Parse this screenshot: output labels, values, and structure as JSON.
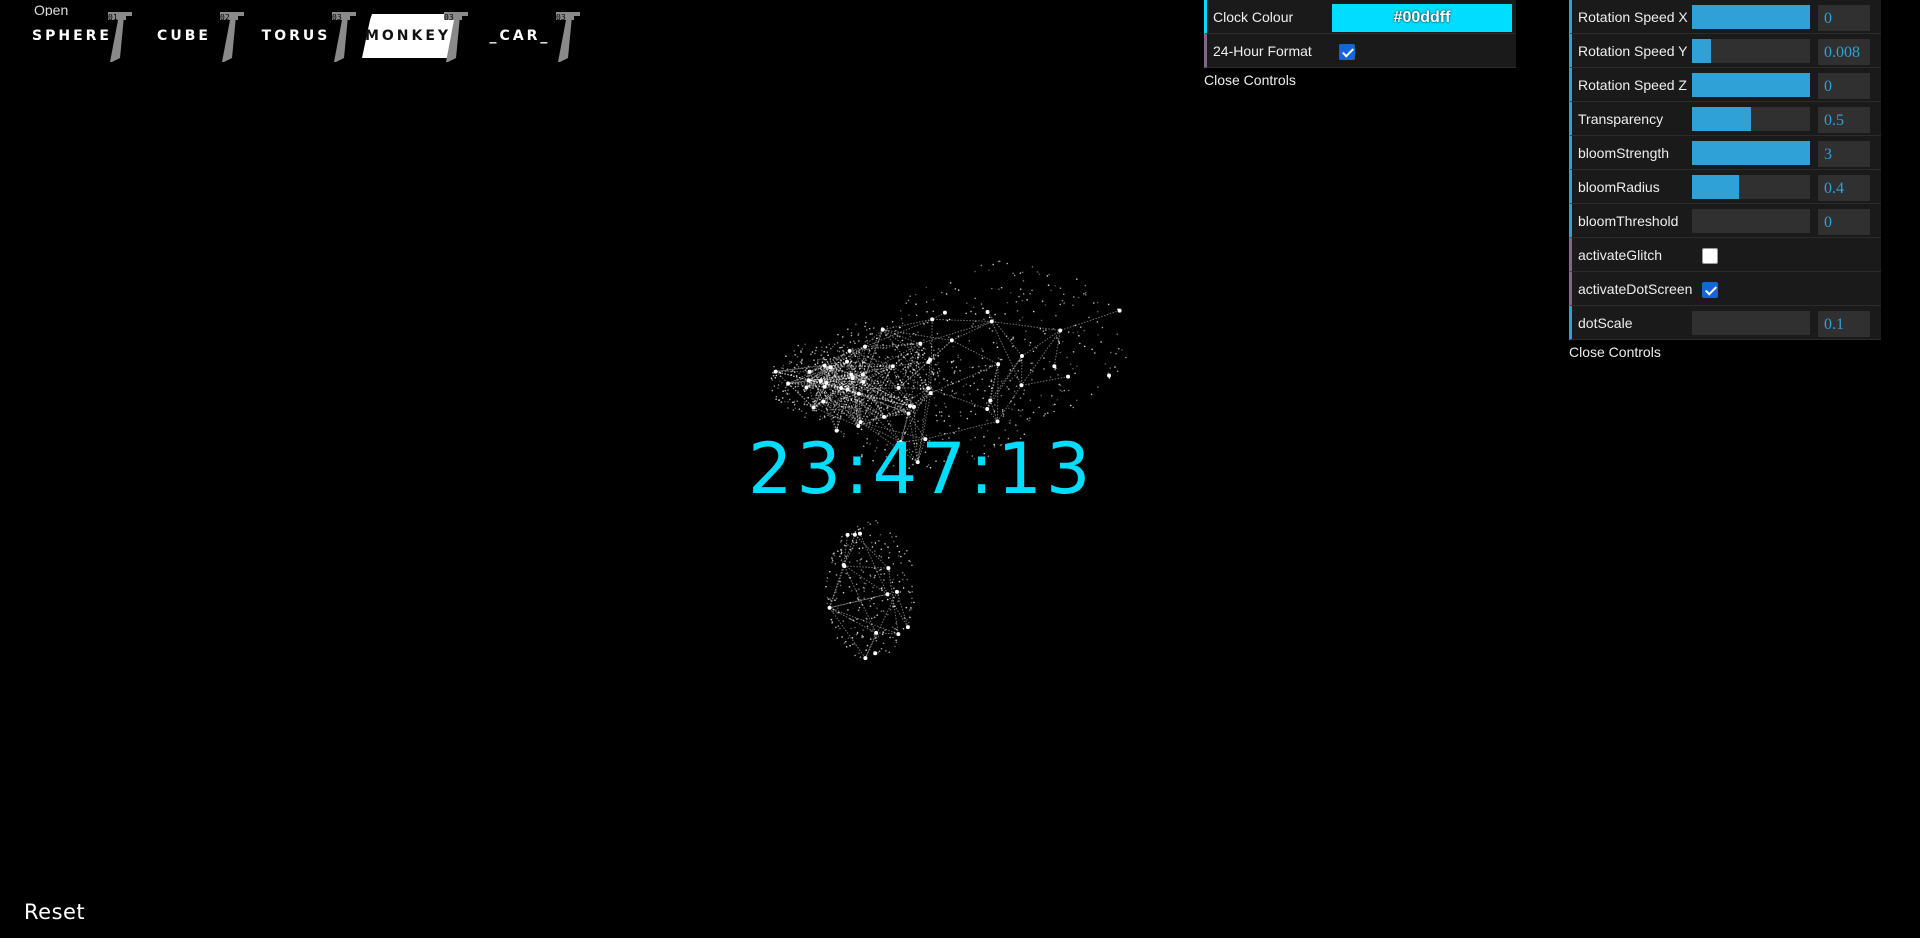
{
  "menu": {
    "open_label": "Open"
  },
  "tabs": [
    {
      "label": "SPHERE",
      "code": "01",
      "active": false
    },
    {
      "label": "CUBE",
      "code": "02",
      "active": false
    },
    {
      "label": "TORUS",
      "code": "03",
      "active": false
    },
    {
      "label": "MONKEY",
      "code": "03",
      "active": true
    },
    {
      "label": "_CAR_",
      "code": "03",
      "active": false
    }
  ],
  "clock": {
    "time": "23:47:13",
    "color": "#00ddff"
  },
  "clock_panel": {
    "colour_label": "Clock Colour",
    "colour_value": "#00ddff",
    "format_label": "24-Hour Format",
    "format_checked": true,
    "close_label": "Close Controls"
  },
  "scene_panel": {
    "rows": [
      {
        "label": "Rotation Speed X",
        "type": "number",
        "value": "0",
        "fill": 1.0
      },
      {
        "label": "Rotation Speed Y",
        "type": "number",
        "value": "0.008",
        "fill": 0.16
      },
      {
        "label": "Rotation Speed Z",
        "type": "number",
        "value": "0",
        "fill": 1.0
      },
      {
        "label": "Transparency",
        "type": "number",
        "value": "0.5",
        "fill": 0.5
      },
      {
        "label": "bloomStrength",
        "type": "number",
        "value": "3",
        "fill": 1.0
      },
      {
        "label": "bloomRadius",
        "type": "number",
        "value": "0.4",
        "fill": 0.4
      },
      {
        "label": "bloomThreshold",
        "type": "number",
        "value": "0",
        "fill": 0.0
      },
      {
        "label": "activateGlitch",
        "type": "boolean",
        "checked": false
      },
      {
        "label": "activateDotScreen",
        "type": "boolean",
        "checked": true
      },
      {
        "label": "dotScale",
        "type": "number",
        "value": "0.1",
        "fill": 0.0
      }
    ],
    "close_label": "Close Controls"
  },
  "reset_label": "Reset"
}
